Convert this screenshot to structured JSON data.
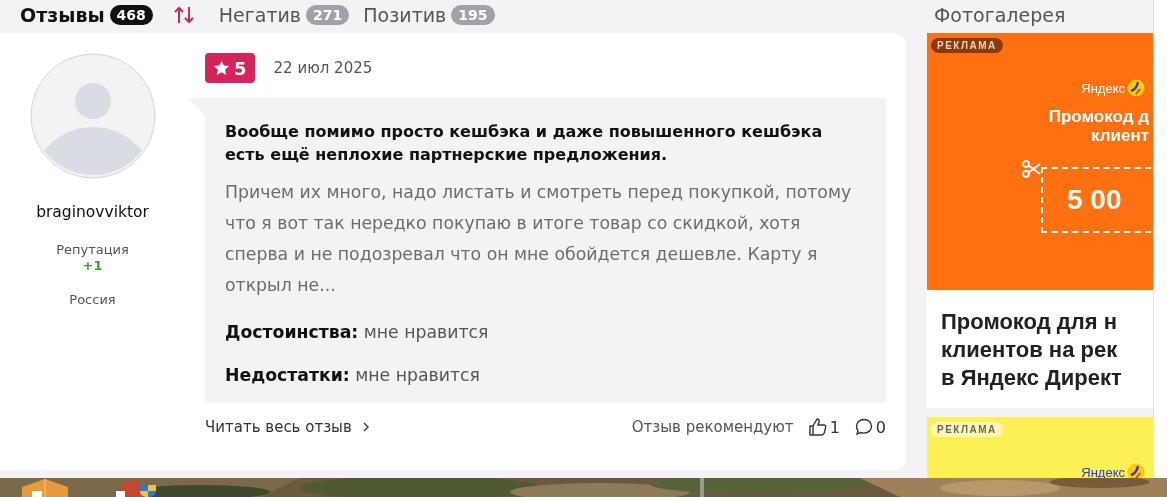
{
  "tabs": [
    {
      "label": "Отзывы",
      "count": "468",
      "selected": true
    },
    {
      "label": "Негатив",
      "count": "271",
      "selected": false
    },
    {
      "label": "Позитив",
      "count": "195",
      "selected": false
    }
  ],
  "sidebar_title": "Фотогалерея",
  "review": {
    "author": {
      "name": "braginovviktor",
      "reputation_label": "Репутация",
      "reputation": "+1",
      "country": "Россия"
    },
    "rating": "5",
    "date": "22 июл 2025",
    "title": "Вообще помимо просто кешбэка и даже повышенного кешбэка есть ещё неплохие партнерские предложения.",
    "text": "Причем их много, надо листать и смотреть перед покупкой, потому что я вот так нередко покупаю в итоге товар со скидкой, хотя сперва и не подозревал что он мне обойдется дешевле. Карту я открыл не...",
    "pros": "**Достоинства:** мне нравится",
    "cons": "**Недостатки:** мне нравится",
    "read_more": "Читать весь отзыв",
    "recommend_label": "Отзыв рекомендуют",
    "likes": "1",
    "comments": "0"
  },
  "ads": [
    {
      "kind": "promo",
      "label": "РЕКЛАМА",
      "brand": "Яндекс",
      "headline_lines": [
        "Промокод д",
        "клиент"
      ],
      "amount": "5 00",
      "title_lines": [
        "Промокод для н",
        "клиентов на рек",
        "в Яндекс Директ"
      ]
    },
    {
      "kind": "teaser",
      "label": "РЕКЛАМА",
      "brand": "Яндекс"
    }
  ]
}
